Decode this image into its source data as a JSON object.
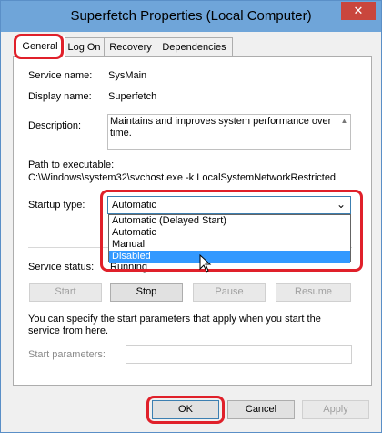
{
  "window": {
    "title": "Superfetch Properties (Local Computer)",
    "close_glyph": "✕"
  },
  "tabs": [
    {
      "label": "General"
    },
    {
      "label": "Log On"
    },
    {
      "label": "Recovery"
    },
    {
      "label": "Dependencies"
    }
  ],
  "general": {
    "service_name_label": "Service name:",
    "service_name_value": "SysMain",
    "display_name_label": "Display name:",
    "display_name_value": "Superfetch",
    "description_label": "Description:",
    "description_value": "Maintains and improves system performance over time.",
    "path_label": "Path to executable:",
    "path_value": "C:\\Windows\\system32\\svchost.exe -k LocalSystemNetworkRestricted",
    "startup_type_label": "Startup type:",
    "startup_type_value": "Automatic",
    "startup_options": [
      "Automatic (Delayed Start)",
      "Automatic",
      "Manual",
      "Disabled"
    ],
    "service_status_label": "Service status:",
    "service_status_value": "Running",
    "buttons": {
      "start": "Start",
      "stop": "Stop",
      "pause": "Pause",
      "resume": "Resume"
    },
    "hint_text": "You can specify the start parameters that apply when you start the service from here.",
    "start_parameters_label": "Start parameters:",
    "start_parameters_value": ""
  },
  "footer": {
    "ok": "OK",
    "cancel": "Cancel",
    "apply": "Apply"
  },
  "colors": {
    "titlebar": "#6fa5d9",
    "highlight": "#e0202a",
    "selection": "#3399ff"
  },
  "icons": {
    "close": "close-icon",
    "dropdown": "chevron-down-icon",
    "cursor": "mouse-cursor-icon"
  }
}
